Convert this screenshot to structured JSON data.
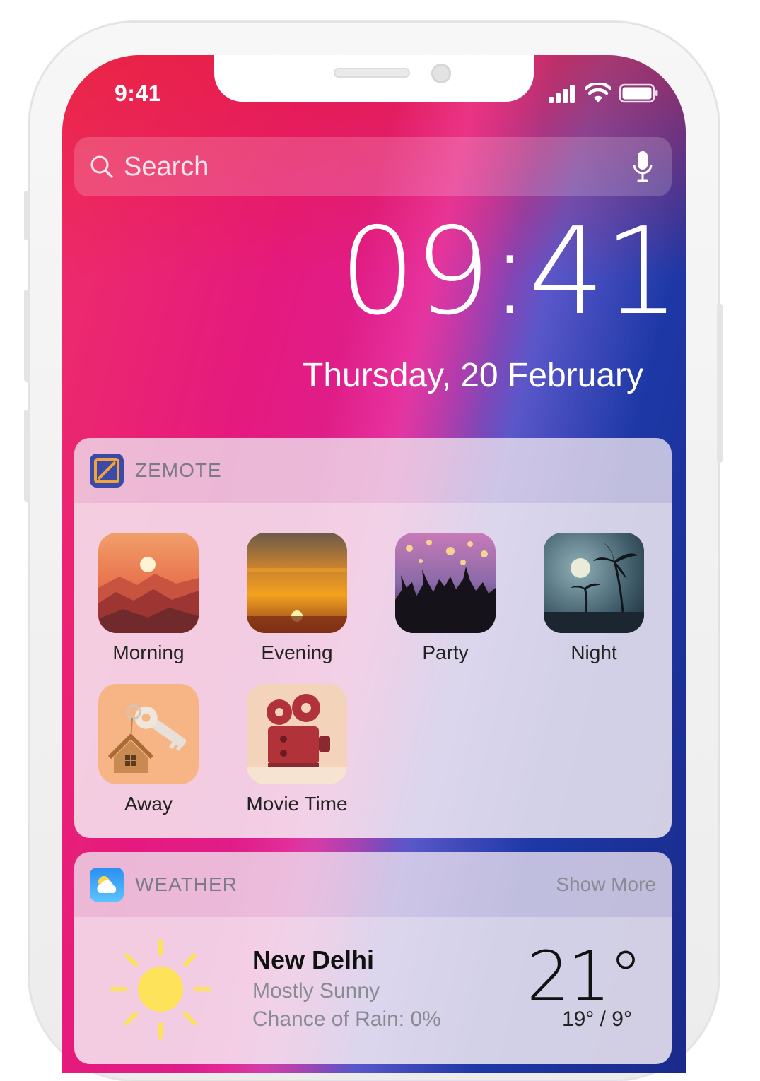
{
  "status_bar": {
    "time": "9:41"
  },
  "search": {
    "placeholder": "Search"
  },
  "lock": {
    "time": "09:41",
    "date": "Thursday, 20 February"
  },
  "zemote": {
    "title": "ZEMOTE",
    "scenes": [
      {
        "label": "Morning",
        "icon": "sunrise-mountains"
      },
      {
        "label": "Evening",
        "icon": "sunset-horizon"
      },
      {
        "label": "Party",
        "icon": "party-crowd"
      },
      {
        "label": "Night",
        "icon": "moon-palms"
      },
      {
        "label": "Away",
        "icon": "house-key"
      },
      {
        "label": "Movie Time",
        "icon": "film-projector"
      }
    ]
  },
  "weather": {
    "title": "WEATHER",
    "show_more": "Show More",
    "city": "New Delhi",
    "condition": "Mostly Sunny",
    "rain": "Chance of Rain: 0%",
    "temperature": "21°",
    "range": "19° / 9°",
    "icon": "sun-icon"
  }
}
